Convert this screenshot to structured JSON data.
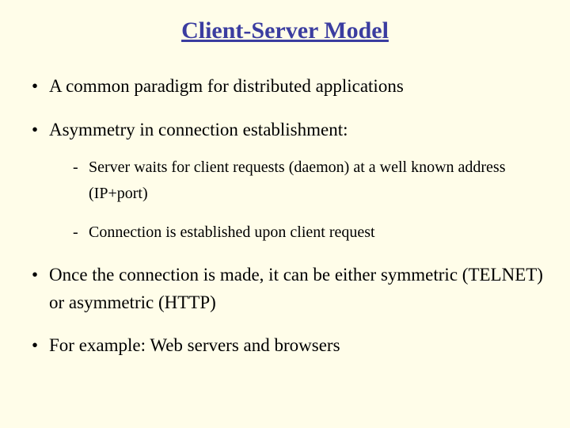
{
  "title": "Client-Server Model",
  "bullets": {
    "b1": "A common paradigm for distributed applications",
    "b2": "Asymmetry in connection establishment:",
    "b2_sub": {
      "s1": "Server waits for client requests (daemon) at a well known address (IP+port)",
      "s2": "Connection is established upon client request"
    },
    "b3": "Once the connection is made, it can be either symmetric (TELNET) or asymmetric (HTTP)",
    "b4": "For example: Web servers and browsers"
  }
}
